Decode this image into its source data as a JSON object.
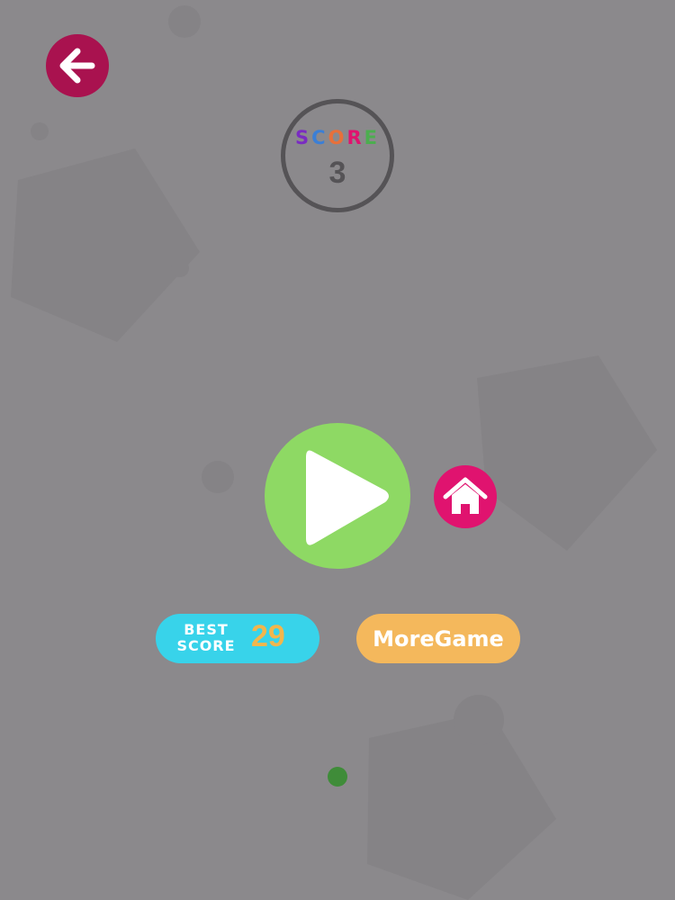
{
  "score": {
    "label_letters": [
      {
        "char": "S",
        "color": "#7a2cc2"
      },
      {
        "char": "C",
        "color": "#3b7fd6"
      },
      {
        "char": "O",
        "color": "#e8703a"
      },
      {
        "char": "R",
        "color": "#e0136f"
      },
      {
        "char": "E",
        "color": "#4cae4f"
      }
    ],
    "value": "3"
  },
  "best_score": {
    "label_line1": "BEST",
    "label_line2": "SCORE",
    "value": "29"
  },
  "more_game": {
    "label": "MoreGame"
  },
  "icons": {
    "back": "arrow-left-icon",
    "play": "play-icon",
    "home": "home-icon"
  },
  "colors": {
    "background": "#8b898c",
    "back_button": "#a9124f",
    "play_button": "#8ed964",
    "home_button": "#e0136f",
    "best_pill": "#38d3ea",
    "best_value": "#f2b64c",
    "more_pill": "#f4b85c",
    "player_dot": "#3f8c39"
  }
}
